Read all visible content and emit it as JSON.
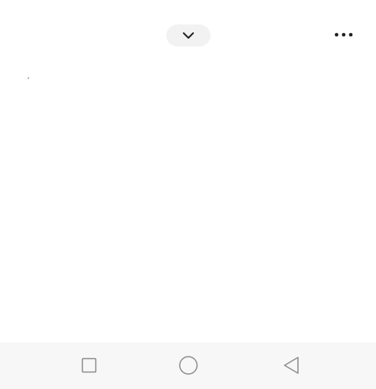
{
  "top_bar": {
    "collapse_icon": "chevron-down-icon",
    "more_icon": "more-horizontal-icon"
  },
  "nav_bar": {
    "recents_icon": "square-icon",
    "home_icon": "circle-icon",
    "back_icon": "triangle-back-icon"
  },
  "colors": {
    "background": "#ffffff",
    "pill_background": "#f2f2f2",
    "nav_background": "#f7f7f7",
    "icon_dark": "#222222",
    "nav_icon": "#8c8c8c"
  }
}
